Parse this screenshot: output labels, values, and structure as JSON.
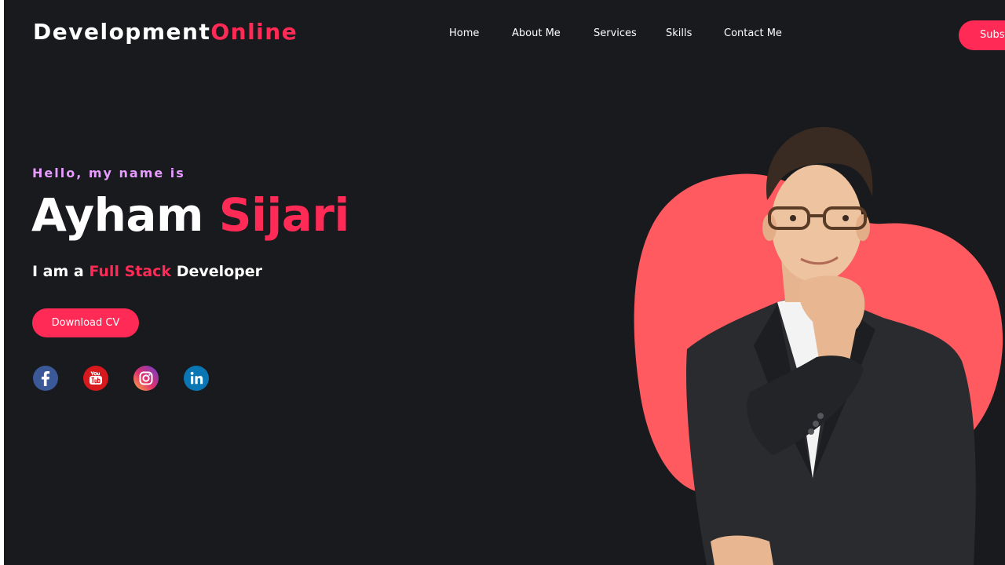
{
  "brand": {
    "part1": "Development",
    "part2": "Online"
  },
  "nav": {
    "items": [
      {
        "label": "Home"
      },
      {
        "label": "About Me"
      },
      {
        "label": "Services"
      },
      {
        "label": "Skills"
      },
      {
        "label": "Contact Me"
      }
    ],
    "subscribe_label": "Subscribe"
  },
  "hero": {
    "greeting": "Hello, my name is",
    "first_name": "Ayham",
    "last_name": "Sijari",
    "tagline_prefix": "I am a",
    "tagline_highlight": "Full Stack",
    "tagline_suffix": "Developer",
    "cv_button": "Download CV"
  },
  "social": [
    "facebook-icon",
    "youtube-icon",
    "instagram-icon",
    "linkedin-icon"
  ],
  "colors": {
    "background": "#181a1e",
    "accent": "#ff2a55",
    "blob": "#ff5a5f",
    "greeting": "#e79bff"
  }
}
